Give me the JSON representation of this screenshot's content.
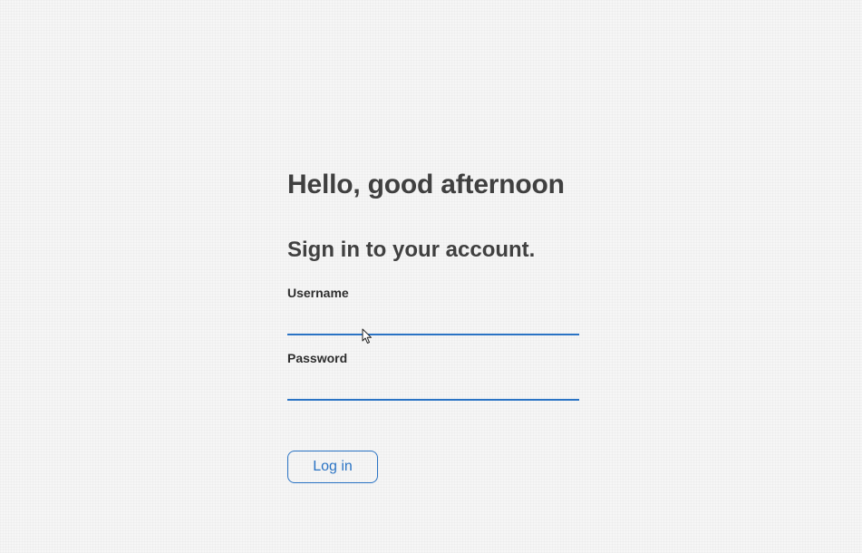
{
  "greeting": "Hello, good afternoon",
  "subtitle": "Sign in to your account.",
  "form": {
    "username_label": "Username",
    "username_value": "",
    "password_label": "Password",
    "password_value": "",
    "login_label": "Log in"
  },
  "colors": {
    "accent": "#2a73c4",
    "heading": "#404040",
    "background": "#f6f6f6"
  },
  "icons": {
    "cursor": "mouse-pointer-icon"
  }
}
